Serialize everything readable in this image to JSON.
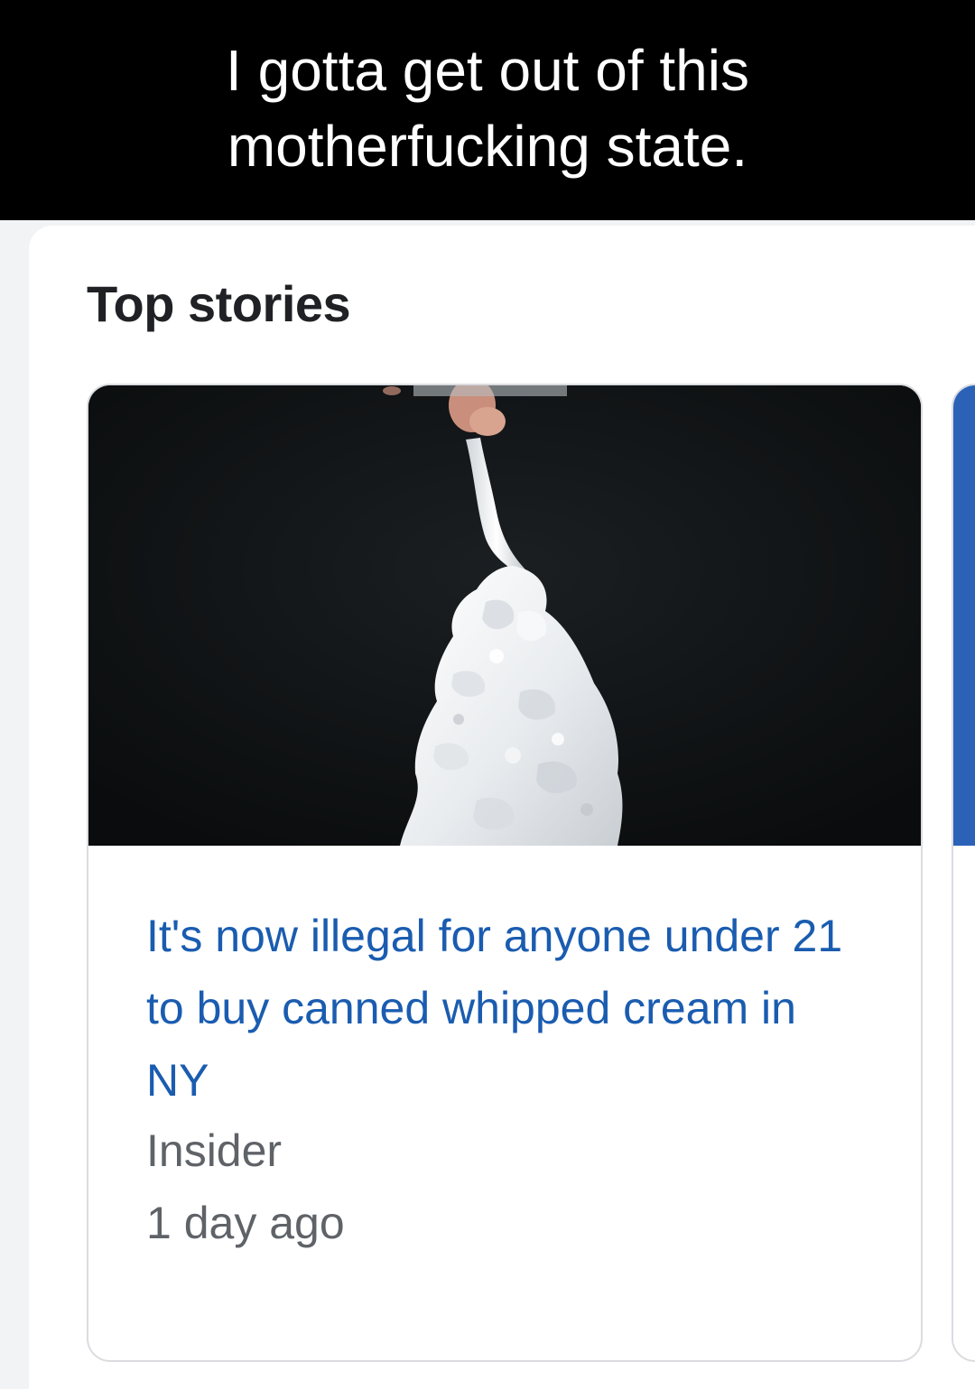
{
  "caption": {
    "text": "I gotta get out of this motherfucking state."
  },
  "top_stories": {
    "title": "Top stories",
    "stories": [
      {
        "headline": "It's now illegal for anyone under 21 to buy canned whipped cream in NY",
        "source": "Insider",
        "time": "1 day ago",
        "image_icon": "whipped-cream-photo"
      }
    ]
  },
  "colors": {
    "caption_bg": "#000000",
    "caption_text": "#ffffff",
    "headline_link": "#1a5cb0",
    "meta_text": "#5f6368",
    "next_card_accent": "#2b62b8"
  }
}
